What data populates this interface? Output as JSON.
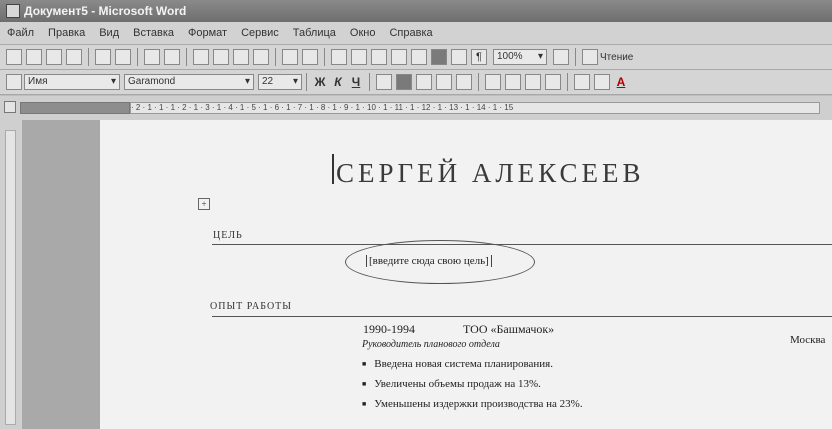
{
  "window": {
    "title": "Документ5 - Microsoft Word"
  },
  "menu": [
    "Файл",
    "Правка",
    "Вид",
    "Вставка",
    "Формат",
    "Сервис",
    "Таблица",
    "Окно",
    "Справка"
  ],
  "toolbar_standard": {
    "zoom": "100%",
    "reading_label": "Чтение"
  },
  "toolbar_format": {
    "style": "Имя",
    "font": "Garamond",
    "size": "22",
    "bold": "Ж",
    "italic": "К",
    "underline": "Ч",
    "font_color": "А"
  },
  "ruler": {
    "marks": "· 2 · 1 · 1 · 1 · 2 · 1 · 3 · 1 · 4 · 1 · 5 · 1 · 6 · 1 · 7 · 1 · 8 · 1 · 9 · 1 · 10 · 1 · 11 · 1 · 12 · 1 · 13 · 1 · 14 · 1 · 15"
  },
  "resume": {
    "name": "СЕРГЕЙ АЛЕКСЕЕВ",
    "goal_heading": "ЦЕЛЬ",
    "goal_placeholder": "[введите сюда свою цель]",
    "experience_heading": "ОПЫТ РАБОТЫ",
    "job": {
      "years": "1990-1994",
      "company": "ТОО «Башмачок»",
      "city": "Москва",
      "position": "Руководитель планового отдела",
      "achievements": [
        "Введена новая система планирования.",
        "Увеличены объемы продаж на 13%.",
        "Уменьшены издержки производства на 23%."
      ]
    }
  }
}
